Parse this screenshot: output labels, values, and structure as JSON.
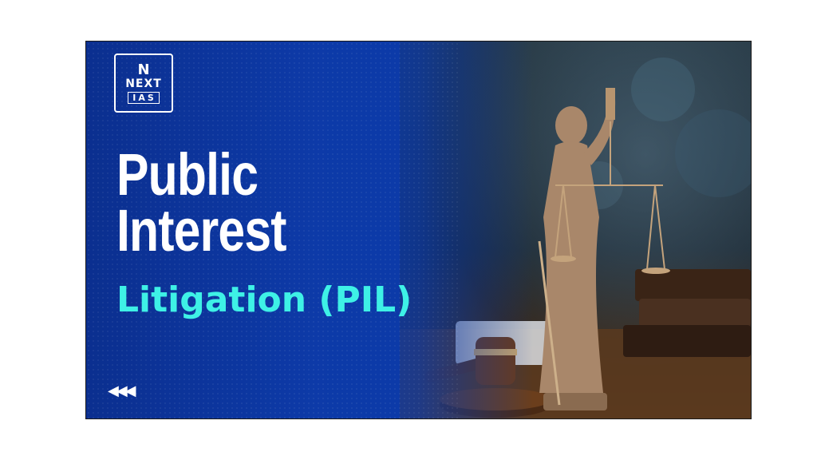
{
  "logo": {
    "mark": "N",
    "word": "NEXT",
    "sub": "IAS"
  },
  "title": {
    "line1": "Public",
    "line2": "Interest"
  },
  "subtitle": "Litigation (PIL)",
  "nav": {
    "arrows": "◀◀◀"
  },
  "colors": {
    "background": "#0d3aa8",
    "title": "#ffffff",
    "subtitle": "#3ef1e6"
  }
}
